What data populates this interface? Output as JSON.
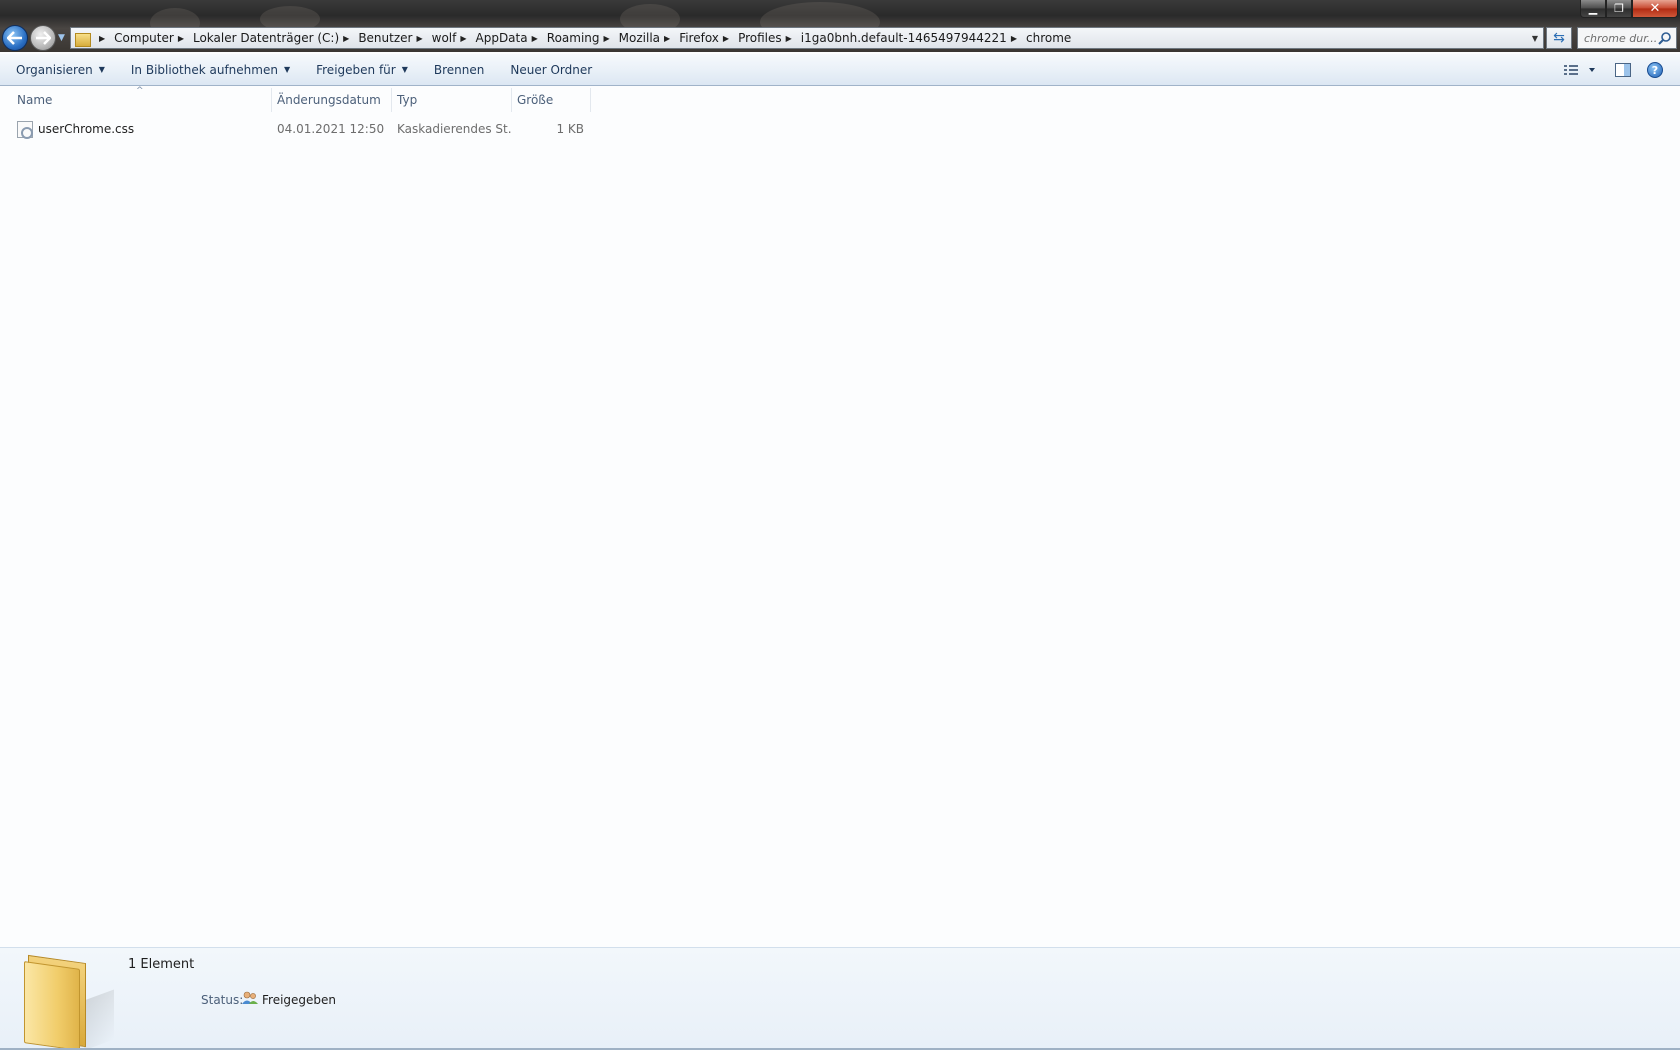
{
  "window": {
    "minimize_label": "▁",
    "maximize_label": "❐",
    "close_label": "✕"
  },
  "address": {
    "crumbs": [
      "Computer",
      "Lokaler Datenträger (C:)",
      "Benutzer",
      "wolf",
      "AppData",
      "Roaming",
      "Mozilla",
      "Firefox",
      "Profiles",
      "i1ga0bnh.default-1465497944221",
      "chrome"
    ]
  },
  "search": {
    "placeholder": "chrome dur..."
  },
  "toolbar": {
    "organize_label": "Organisieren",
    "library_label": "In Bibliothek aufnehmen",
    "share_label": "Freigeben für",
    "burn_label": "Brennen",
    "new_folder_label": "Neuer Ordner"
  },
  "columns": {
    "name": "Name",
    "date": "Änderungsdatum",
    "type": "Typ",
    "size": "Größe"
  },
  "files": [
    {
      "name": "userChrome.css",
      "date": "04.01.2021 12:50",
      "type": "Kaskadierendes St...",
      "size": "1 KB"
    }
  ],
  "details": {
    "count": "1 Element",
    "status_label": "Status:",
    "status_value": "Freigegeben"
  },
  "colors": {
    "accent": "#1e395b",
    "selection": "#cce8ff",
    "back_button": "#2a6fc4"
  }
}
